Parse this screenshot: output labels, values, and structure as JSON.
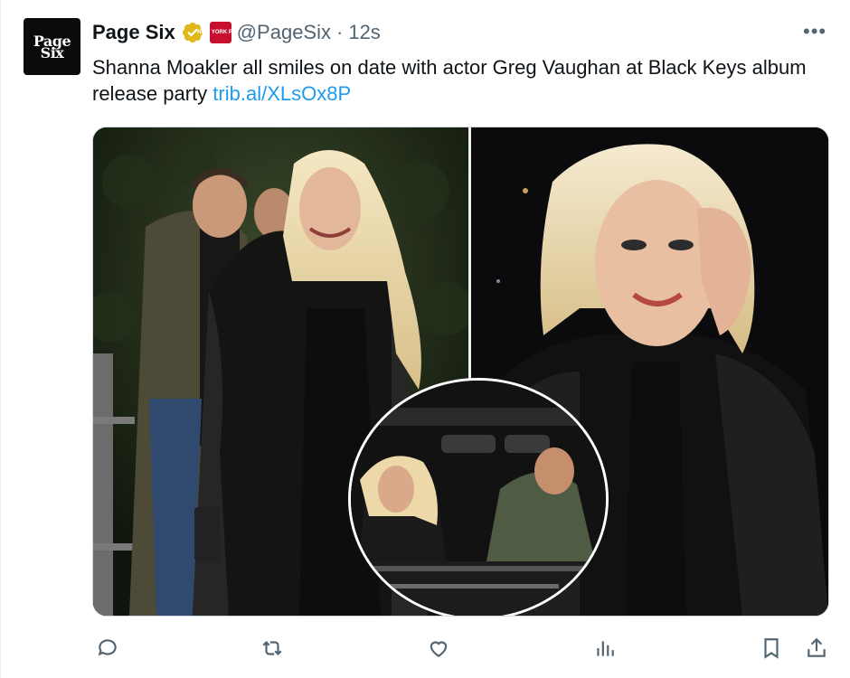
{
  "account": {
    "name": "Page Six",
    "handle": "@PageSix",
    "separator": "·",
    "time": "12s",
    "avatar_text_top": "Page",
    "avatar_text_bottom": "Six",
    "affiliate_badge_text": "NEW YORK POST"
  },
  "tweet": {
    "text": "Shanna Moakler all smiles on date with actor Greg Vaughan at Black Keys album release party ",
    "link": "trib.al/XLsOx8P"
  },
  "media": {
    "images": [
      {
        "name": "photo-couple-walking"
      },
      {
        "name": "photo-woman-closeup"
      },
      {
        "name": "photo-inset-car"
      }
    ]
  },
  "actions": {
    "icons": [
      "reply-icon",
      "retweet-icon",
      "like-icon",
      "views-icon",
      "bookmark-icon",
      "share-icon"
    ]
  },
  "colors": {
    "text": "#0f1419",
    "muted": "#536471",
    "link": "#1d9bf0",
    "verified_gold": "#e2b719",
    "affiliate_red": "#c8102e"
  }
}
